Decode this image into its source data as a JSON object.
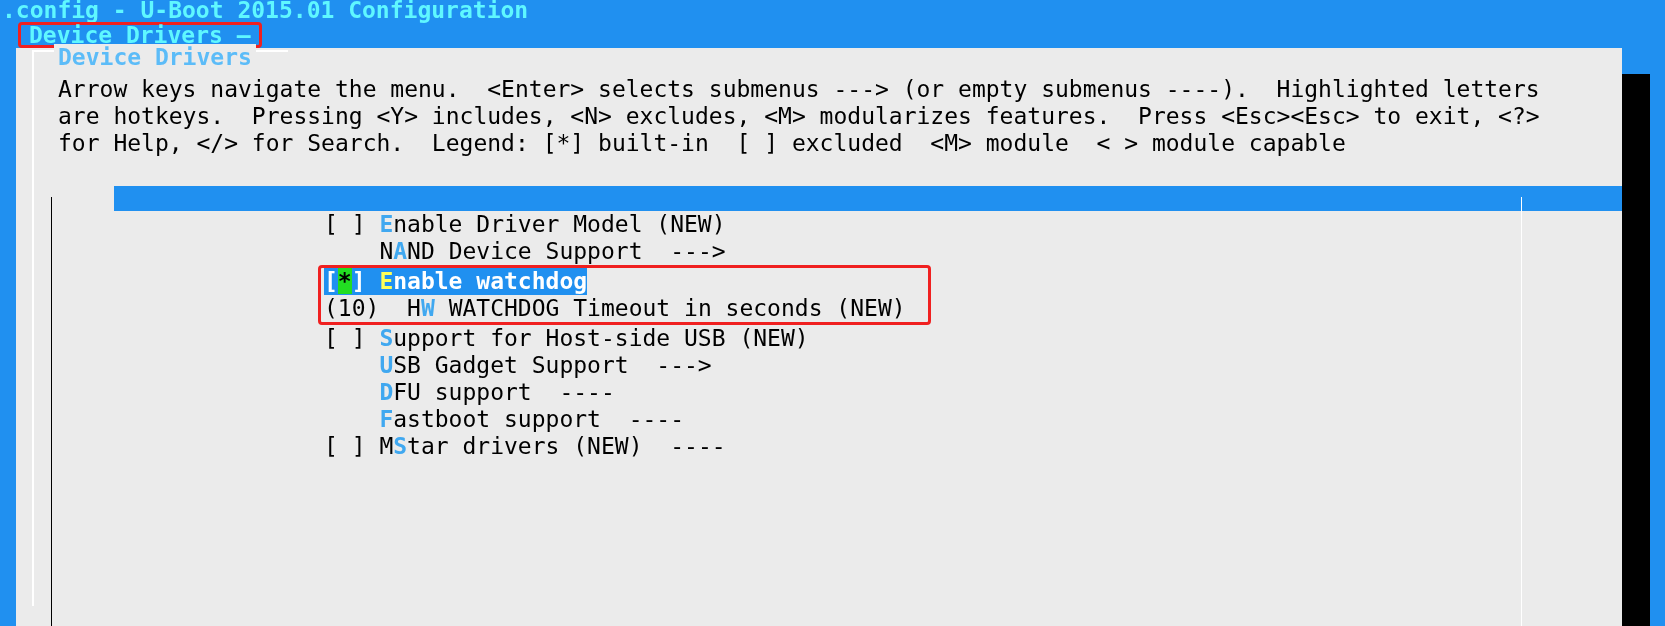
{
  "title": ".config - U-Boot 2015.01 Configuration",
  "breadcrumb": {
    "text": "Device Drivers —",
    "marked": true
  },
  "panel": {
    "title": "Device Drivers",
    "help_lines": [
      "Arrow keys navigate the menu.  <Enter> selects submenus ---> (or empty submenus ----).  Highlighted letters",
      "are hotkeys.  Pressing <Y> includes, <N> excludes, <M> modularizes features.  Press <Esc><Esc> to exit, <?>",
      "for Help, </> for Search.  Legend: [*] built-in  [ ] excluded  <M> module  < > module capable"
    ]
  },
  "menu": {
    "groups": [
      {
        "marked": false,
        "items": [
          {
            "kind": "bool",
            "box": "[ ]",
            "hotkey": "E",
            "after": "nable Driver Model (NEW)",
            "selected": false
          },
          {
            "kind": "menu",
            "before": "N",
            "hotkey": "A",
            "after": "ND Device Support  --->",
            "selected": false
          }
        ]
      },
      {
        "marked": true,
        "items": [
          {
            "kind": "bool",
            "box": "[*]",
            "hotkey": "E",
            "after": "nable watchdog",
            "selected": true
          },
          {
            "kind": "value",
            "box": "(10)",
            "before": "H",
            "hotkey": "W",
            "after": " WATCHDOG Timeout in seconds (NEW)",
            "selected": false
          }
        ]
      },
      {
        "marked": false,
        "items": [
          {
            "kind": "bool",
            "box": "[ ]",
            "hotkey": "S",
            "after": "upport for Host-side USB (NEW)",
            "selected": false
          },
          {
            "kind": "menu",
            "hotkey": "U",
            "after": "SB Gadget Support  --->",
            "selected": false
          },
          {
            "kind": "menu",
            "hotkey": "D",
            "after": "FU support  ----",
            "selected": false
          },
          {
            "kind": "menu",
            "hotkey": "F",
            "after": "astboot support  ----",
            "selected": false
          },
          {
            "kind": "bool",
            "box": "[ ]",
            "before": "M",
            "hotkey": "S",
            "after": "tar drivers (NEW)  ----",
            "selected": false
          }
        ]
      }
    ]
  }
}
